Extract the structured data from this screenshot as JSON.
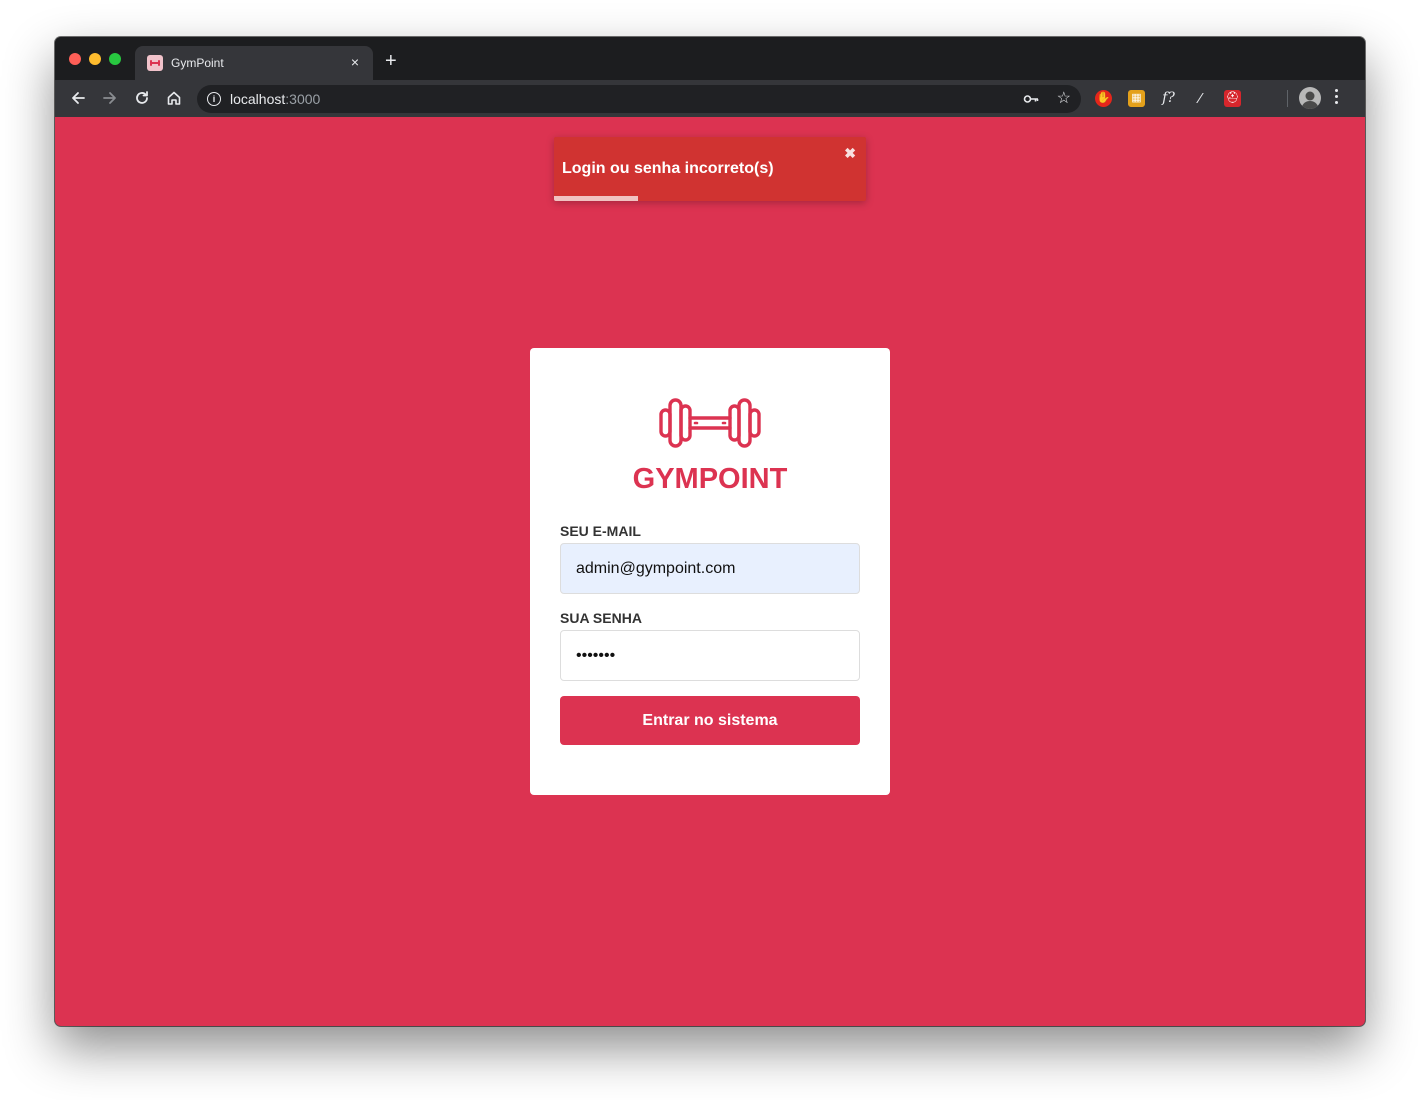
{
  "browser": {
    "tab": {
      "title": "GymPoint",
      "close_glyph": "×",
      "favicon": "gympoint-favicon"
    },
    "new_tab_glyph": "+",
    "address": {
      "host": "localhost",
      "port": ":3000",
      "info_glyph": "i"
    },
    "icons": {
      "back": "arrow-left-icon",
      "forward": "arrow-right-icon",
      "reload": "reload-icon",
      "home": "home-icon",
      "key": "key-icon",
      "bookmark": "star-icon",
      "menu": "kebab-menu-icon"
    },
    "extensions": [
      {
        "name": "adblock-extension",
        "color": "#e5261b",
        "glyph": "✋"
      },
      {
        "name": "colorpick-extension",
        "color": "#e4a11b",
        "glyph": "▦"
      },
      {
        "name": "whatfont-extension",
        "color": "transparent",
        "glyph": "f?"
      },
      {
        "name": "eyedropper-extension",
        "color": "transparent",
        "glyph": "⁄"
      },
      {
        "name": "redux-devtools-extension",
        "color": "#d7262c",
        "glyph": "⛑"
      }
    ]
  },
  "toast": {
    "message": "Login ou senha incorreto(s)",
    "close_glyph": "✖",
    "progress": 0.27
  },
  "login": {
    "brand": "GYMPOINT",
    "brand_color": "#dc3351",
    "email_label": "SEU E-MAIL",
    "email_value": "admin@gympoint.com",
    "password_label": "SUA SENHA",
    "password_value": "1234567",
    "submit_label": "Entrar no sistema"
  }
}
